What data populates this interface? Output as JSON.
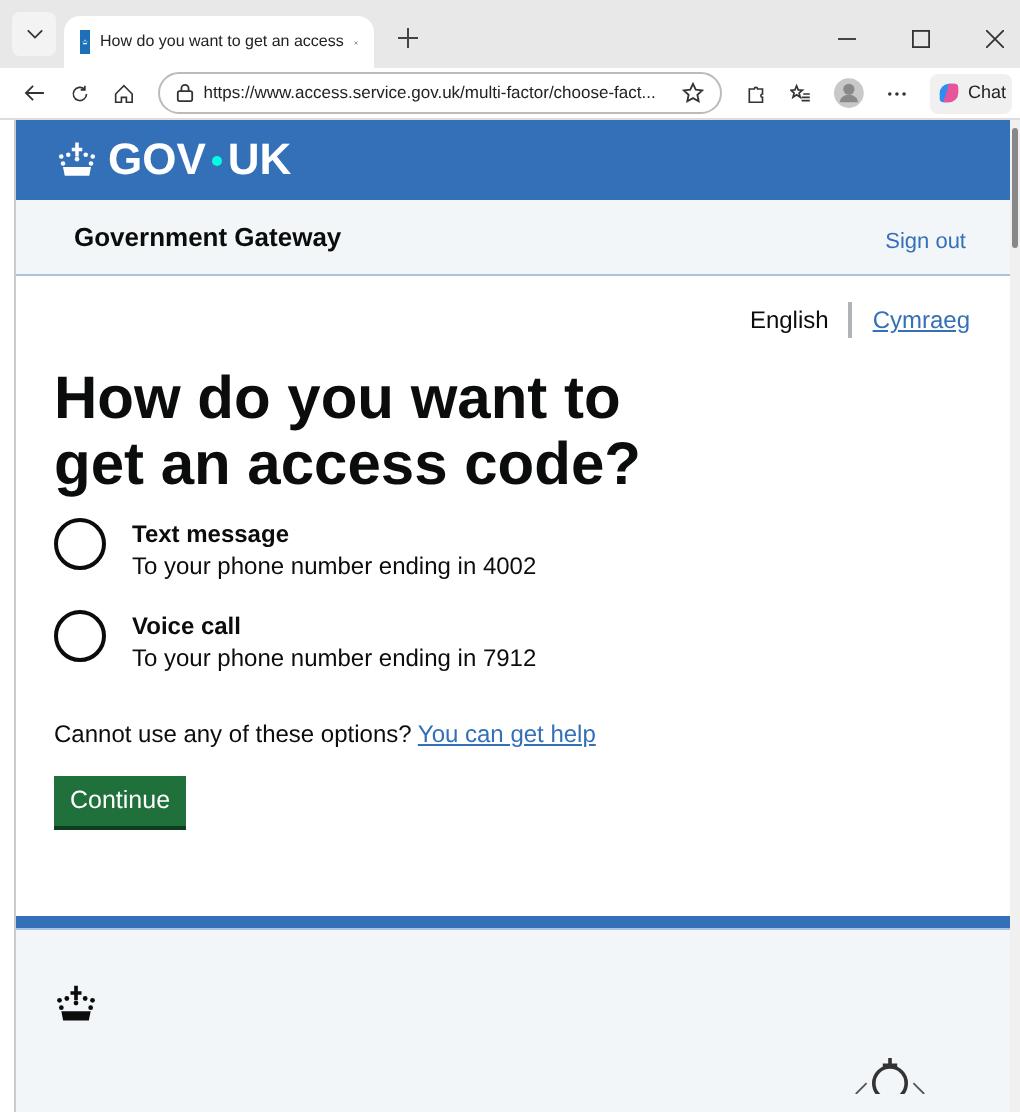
{
  "browser": {
    "tab_title": "How do you want to get an access",
    "url": "https://www.access.service.gov.uk/multi-factor/choose-fact...",
    "chat_label": "Chat"
  },
  "header": {
    "logo_text": "GOV",
    "logo_text_2": "UK"
  },
  "service_bar": {
    "name": "Government Gateway",
    "sign_out": "Sign out"
  },
  "languages": [
    {
      "label": "English",
      "selected": true
    },
    {
      "label": "Cymraeg",
      "selected": false
    }
  ],
  "heading": "How do you want to get an access code?",
  "options": [
    {
      "label": "Text message",
      "hint": "To your phone number ending in 4002",
      "selected": false
    },
    {
      "label": "Voice call",
      "hint": "To your phone number ending in 7912",
      "selected": false
    }
  ],
  "help": {
    "text": "Cannot use any of these options?",
    "link": "You can get help"
  },
  "continue_button": "Continue"
}
